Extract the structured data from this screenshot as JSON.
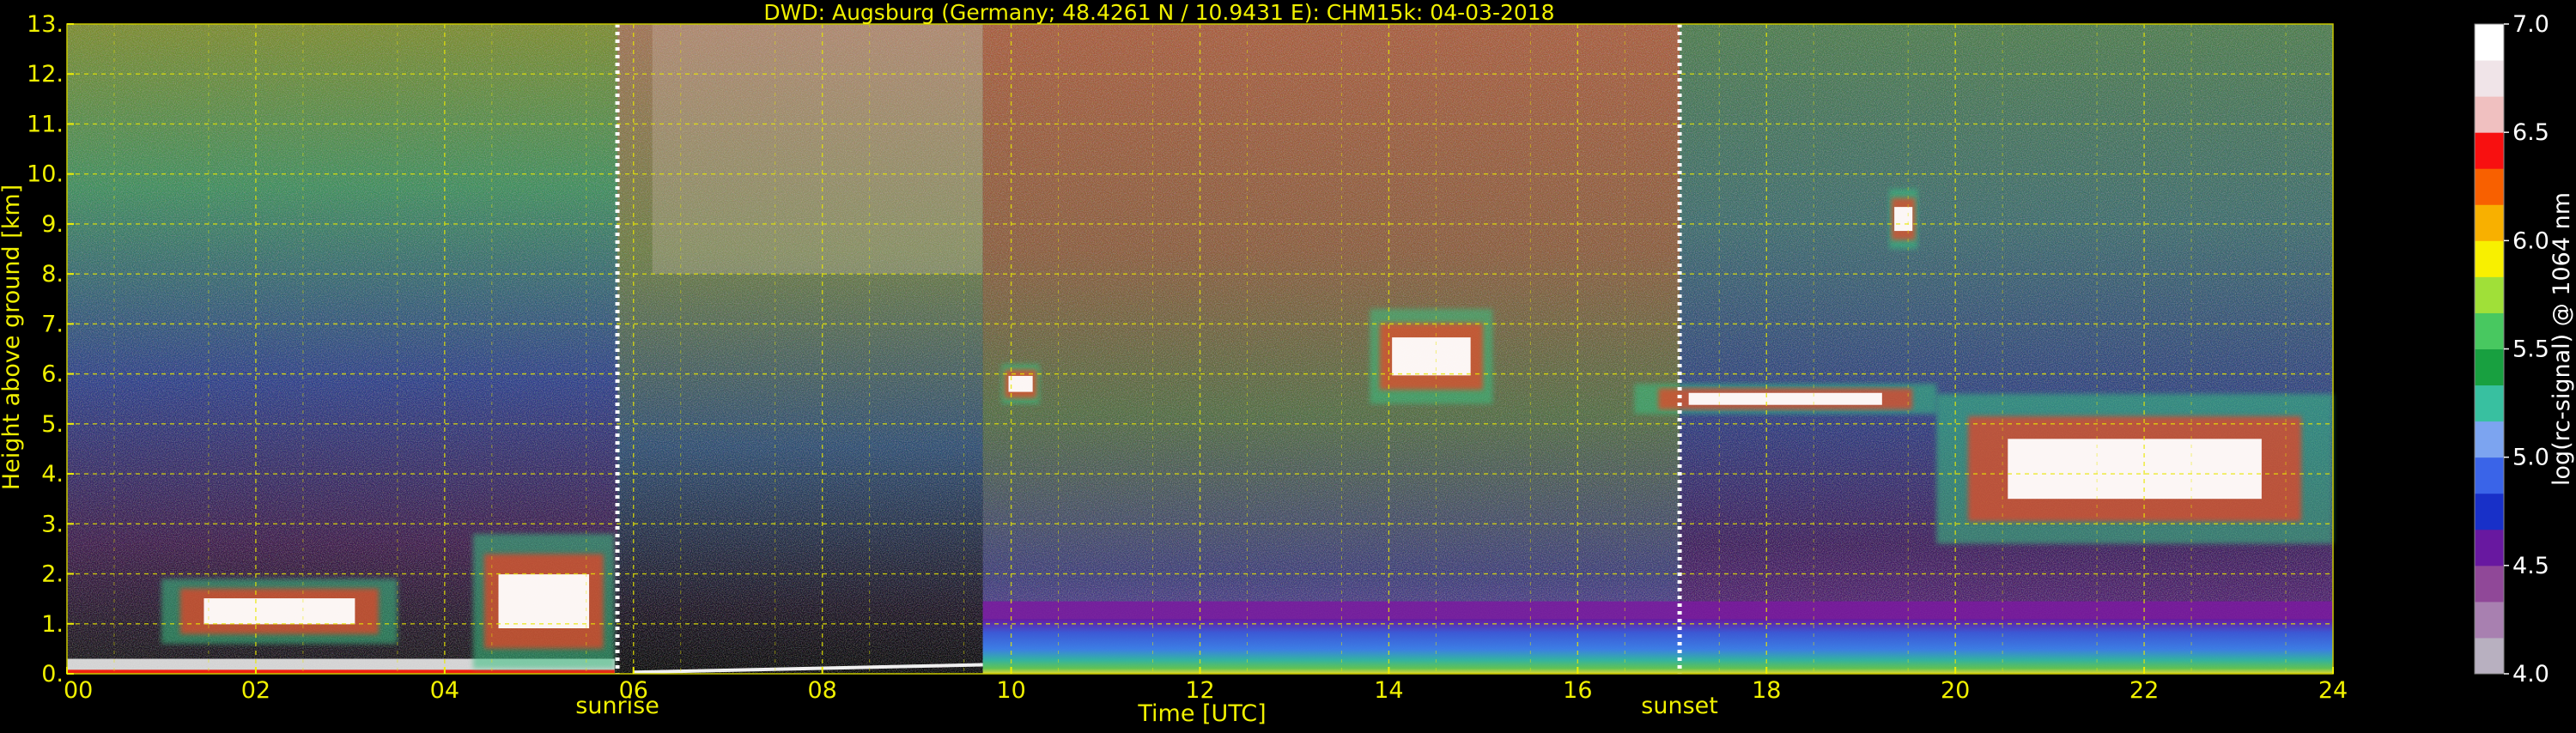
{
  "chart_data": {
    "type": "heatmap",
    "title": "DWD: Augsburg (Germany; 48.4261 N / 10.9431 E):    CHM15k: 04-03-2018",
    "xlabel": "Time [UTC]",
    "ylabel": "Height above ground [km]",
    "xlim": [
      0,
      24
    ],
    "ylim": [
      0,
      13
    ],
    "x_ticks": [
      0,
      2,
      4,
      6,
      8,
      10,
      12,
      14,
      16,
      18,
      20,
      22,
      24
    ],
    "x_tick_labels": [
      "00",
      "02",
      "04",
      "06",
      "08",
      "10",
      "12",
      "14",
      "16",
      "18",
      "20",
      "22",
      "24"
    ],
    "y_ticks": [
      0,
      1,
      2,
      3,
      4,
      5,
      6,
      7,
      8,
      9,
      10,
      11,
      12,
      13
    ],
    "y_tick_labels": [
      "0.",
      "1.",
      "2.",
      "3.",
      "4.",
      "5.",
      "6.",
      "7.",
      "8.",
      "9.",
      "10.",
      "11.",
      "12.",
      "13."
    ],
    "grid": true,
    "colorbar": {
      "label": "log(rc-signal) @ 1064 nm",
      "range": [
        4.0,
        7.0
      ],
      "ticks": [
        4.0,
        4.5,
        5.0,
        5.5,
        6.0,
        6.5,
        7.0
      ],
      "tick_labels": [
        "4.0",
        "4.5",
        "5.0",
        "5.5",
        "6.0",
        "6.5",
        "7.0"
      ],
      "colors": [
        "#b8b0c0",
        "#a880b0",
        "#904898",
        "#6818a0",
        "#1830c8",
        "#3a64e8",
        "#7ca4f0",
        "#38c0a0",
        "#18a040",
        "#48c860",
        "#a0e038",
        "#f8f000",
        "#f8b000",
        "#f86000",
        "#f81010",
        "#f0c0c0",
        "#f0e4e8",
        "#ffffff"
      ]
    },
    "markers": [
      {
        "label": "sunrise",
        "x": 5.83
      },
      {
        "label": "sunset",
        "x": 17.08
      }
    ],
    "features": {
      "background_noise_top_km": 13,
      "boundary_layer": [
        {
          "x0": 0,
          "x1": 5.8,
          "top_km": 0.3
        },
        {
          "x0": 9.7,
          "x1": 24,
          "top_km": 1.1
        }
      ],
      "cloud_layers": [
        {
          "x0": 16.6,
          "x1": 19.8,
          "base_km": 5.2,
          "top_km": 5.8
        },
        {
          "x0": 19.8,
          "x1": 24,
          "base_km": 2.6,
          "top_km": 5.6
        },
        {
          "x0": 13.8,
          "x1": 15.1,
          "base_km": 5.4,
          "top_km": 7.3
        },
        {
          "x0": 9.9,
          "x1": 10.3,
          "base_km": 5.4,
          "top_km": 6.2
        },
        {
          "x0": 19.3,
          "x1": 19.6,
          "base_km": 8.5,
          "top_km": 9.7
        },
        {
          "x0": 1.0,
          "x1": 3.5,
          "base_km": 0.6,
          "top_km": 1.9
        },
        {
          "x0": 4.3,
          "x1": 5.8,
          "base_km": 0.1,
          "top_km": 2.8
        }
      ]
    }
  }
}
